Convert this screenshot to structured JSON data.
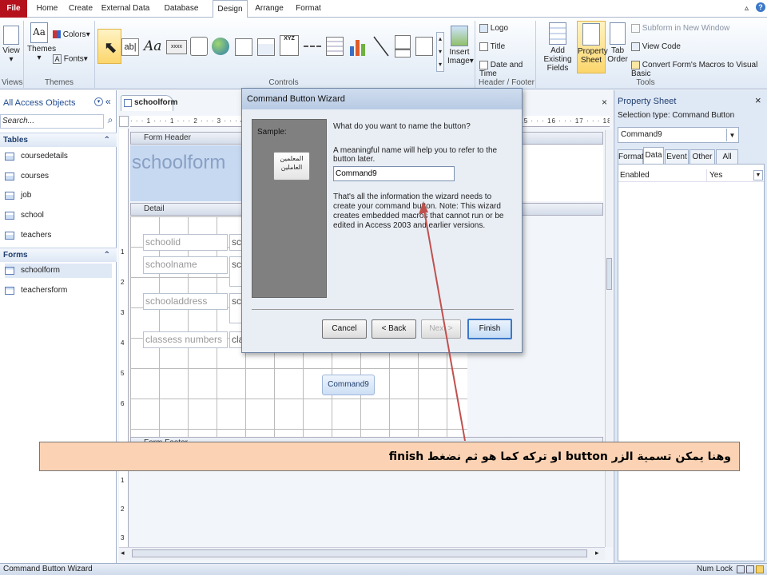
{
  "ribbon_tabs": [
    "File",
    "Home",
    "Create",
    "External Data",
    "Database Tools",
    "Design",
    "Arrange",
    "Format"
  ],
  "ribbon": {
    "view_label": "View",
    "themes_label": "Themes",
    "colors_label": "Colors",
    "fonts_label": "Fonts",
    "views_group": "Views",
    "themes_group": "Themes",
    "controls_group": "Controls",
    "insert_image_label": "Insert Image",
    "logo_label": "Logo",
    "title_label": "Title",
    "date_time_label": "Date and Time",
    "header_footer_group": "Header / Footer",
    "add_fields_label": "Add Existing Fields",
    "property_sheet_label": "Property Sheet",
    "tab_order_label": "Tab Order",
    "subform_label": "Subform in New Window",
    "view_code_label": "View Code",
    "convert_macros_label": "Convert Form's Macros to Visual Basic",
    "tools_group": "Tools"
  },
  "nav": {
    "header": "All Access Objects",
    "search_placeholder": "Search...",
    "tables_label": "Tables",
    "tables": [
      "coursedetails",
      "courses",
      "job",
      "school",
      "teachers"
    ],
    "forms_label": "Forms",
    "forms": [
      "schoolform",
      "teachersform"
    ]
  },
  "doc": {
    "tab_label": "schoolform",
    "form_header_band": "Form Header",
    "form_title": "schoolform",
    "detail_band": "Detail",
    "form_footer_band": "Form Footer",
    "fields": [
      "schoolid",
      "schoolname",
      "schooladdress",
      "classess numbers"
    ],
    "field_boxes": [
      "sch",
      "sch",
      "sch",
      "cla"
    ],
    "command_button": "Command9",
    "ruler_left_numbers": [
      "1",
      "2",
      "3",
      "4",
      "5",
      "6"
    ],
    "ruler_footer_numbers": [
      "1",
      "2",
      "3"
    ]
  },
  "dialog": {
    "title": "Command Button Wizard",
    "sample_label": "Sample:",
    "sample_text": "المعلمين العاملين",
    "question": "What do you want to name the button?",
    "hint": "A meaningful name will help you to refer to the button later.",
    "name_value": "Command9",
    "info": "That's all the information the wizard needs to create your command button. Note: This wizard creates embedded macros that cannot run or be edited in Access 2003 and earlier versions.",
    "cancel": "Cancel",
    "back": "< Back",
    "next": "Next >",
    "finish": "Finish"
  },
  "property_sheet": {
    "title": "Property Sheet",
    "selection_type": "Selection type:  Command Button",
    "selected": "Command9",
    "tabs": [
      "Format",
      "Data",
      "Event",
      "Other",
      "All"
    ],
    "active_tab": "Data",
    "prop_name": "Enabled",
    "prop_value": "Yes"
  },
  "status": {
    "left": "Command Button Wizard",
    "num_lock": "Num Lock"
  },
  "caption": "وهنا يمكن تسمية الزر button او تركه كما هو ثم نضغط finish",
  "colors": {
    "file_tab": "#b4111c",
    "caption_bg": "#fbd3b4",
    "arrow": "#c0504d"
  }
}
